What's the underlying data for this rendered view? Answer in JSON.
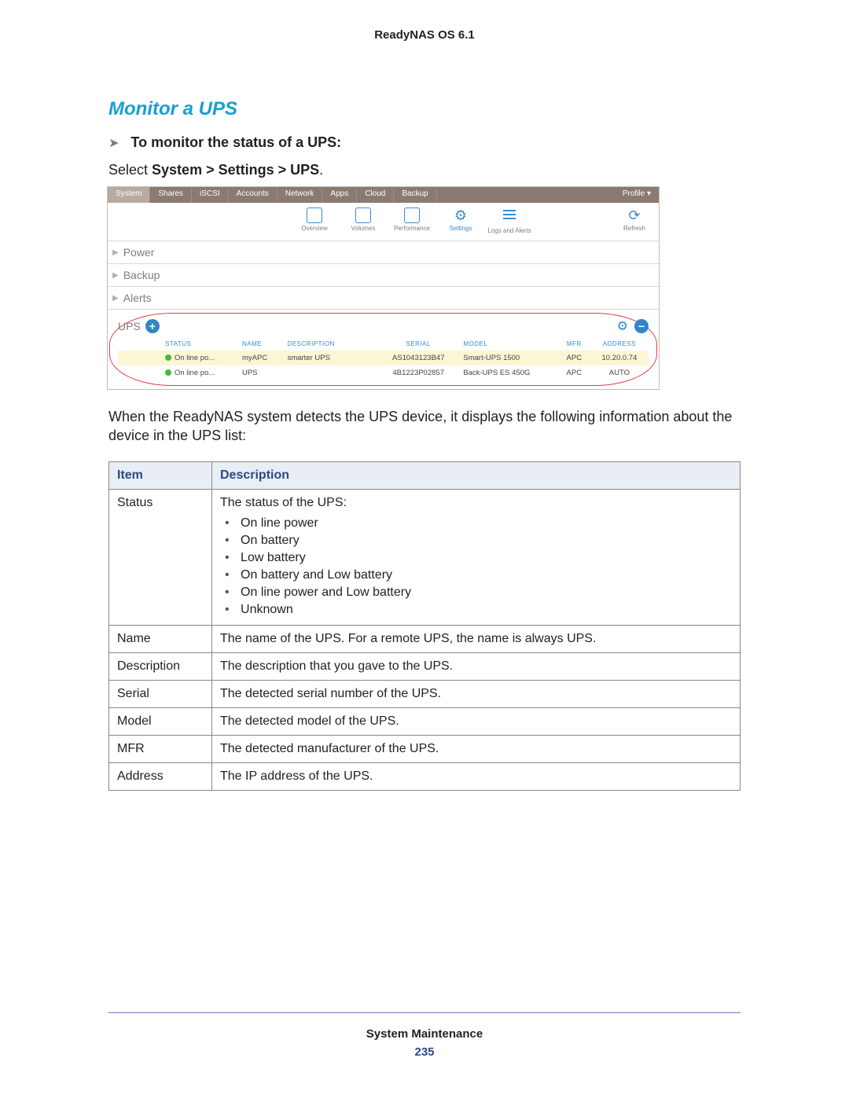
{
  "header": {
    "product": "ReadyNAS OS 6.1"
  },
  "section": {
    "title": "Monitor a UPS",
    "task_arrow": "➤",
    "task": "To monitor the status of a UPS:",
    "instruction_prefix": "Select ",
    "instruction_path": "System > Settings > UPS",
    "instruction_suffix": "."
  },
  "app": {
    "tabs": [
      "System",
      "Shares",
      "iSCSI",
      "Accounts",
      "Network",
      "Apps",
      "Cloud",
      "Backup"
    ],
    "active_tab": "System",
    "profile_label": "Profile ▾",
    "toolbar": {
      "overview": "Overview",
      "volumes": "Volumes",
      "performance": "Performance",
      "settings": "Settings",
      "logs": "Logs and Alerts",
      "refresh": "Refresh"
    },
    "panels": [
      "Power",
      "Backup",
      "Alerts"
    ],
    "ups": {
      "label": "UPS",
      "columns": [
        "STATUS",
        "NAME",
        "DESCRIPTION",
        "SERIAL",
        "MODEL",
        "MFR",
        "ADDRESS"
      ],
      "rows": [
        {
          "status": "On line po...",
          "name": "myAPC",
          "description": "smarter UPS",
          "serial": "AS1043123B47",
          "model": "Smart-UPS 1500",
          "mfr": "APC",
          "address": "10.20.0.74",
          "selected": true
        },
        {
          "status": "On line po...",
          "name": "UPS",
          "description": "",
          "serial": "4B1223P02857",
          "model": "Back-UPS ES 450G",
          "mfr": "APC",
          "address": "AUTO",
          "selected": false
        }
      ]
    }
  },
  "body_text": "When the ReadyNAS system detects the UPS device, it displays the following information about the device in the UPS list:",
  "info_table": {
    "headers": [
      "Item",
      "Description"
    ],
    "rows": [
      {
        "item": "Status",
        "desc": "The status of the UPS:",
        "bullets": [
          "On line power",
          "On battery",
          "Low battery",
          "On battery and Low battery",
          "On line power and Low battery",
          "Unknown"
        ]
      },
      {
        "item": "Name",
        "desc": "The name of the UPS. For a remote UPS, the name is always UPS."
      },
      {
        "item": "Description",
        "desc": "The description that you gave to the UPS."
      },
      {
        "item": "Serial",
        "desc": "The detected serial number of the UPS."
      },
      {
        "item": "Model",
        "desc": "The detected model of the UPS."
      },
      {
        "item": "MFR",
        "desc": "The detected manufacturer of the UPS."
      },
      {
        "item": "Address",
        "desc": "The IP address of the UPS."
      }
    ]
  },
  "footer": {
    "title": "System Maintenance",
    "page_number": "235"
  }
}
